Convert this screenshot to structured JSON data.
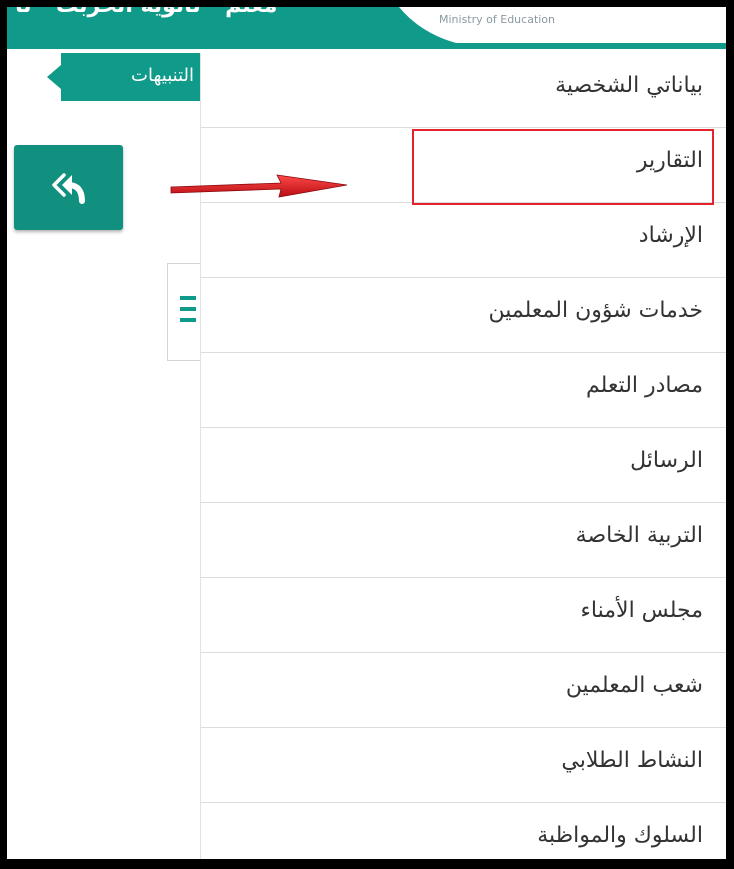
{
  "header": {
    "title": "معلم - ثانوية الحزبث - ثا",
    "ministry_text": "Ministry of Education"
  },
  "alerts": {
    "label": "التنبيهات"
  },
  "menu": {
    "items": [
      {
        "label": "بياناتي الشخصية"
      },
      {
        "label": "التقارير"
      },
      {
        "label": "الإرشاد"
      },
      {
        "label": "خدمات شؤون المعلمين"
      },
      {
        "label": "مصادر التعلم"
      },
      {
        "label": "الرسائل"
      },
      {
        "label": "التربية الخاصة"
      },
      {
        "label": "مجلس الأمناء"
      },
      {
        "label": "شعب المعلمين"
      },
      {
        "label": "النشاط الطلابي"
      },
      {
        "label": "السلوك والمواظبة"
      }
    ]
  },
  "colors": {
    "brand": "#0f9a8a",
    "highlight": "#e4232a",
    "arrow": "#e4232a"
  },
  "icons": [
    "back-arrow-icon",
    "menu-icon",
    "red-arrow-icon"
  ]
}
